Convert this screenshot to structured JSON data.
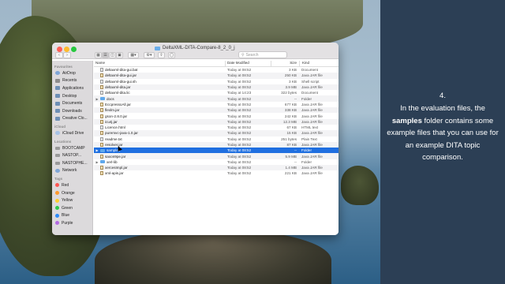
{
  "window": {
    "title": "DeltaXML-DITA-Compare-8_2_0_j",
    "search_placeholder": "Search"
  },
  "sidebar": {
    "sections": [
      {
        "header": "Favourites",
        "items": [
          {
            "label": "AirDrop",
            "icon": "airdrop-icon"
          },
          {
            "label": "Recents",
            "icon": "clock-icon"
          },
          {
            "label": "Applications",
            "icon": "applications-icon"
          },
          {
            "label": "Desktop",
            "icon": "desktop-icon"
          },
          {
            "label": "Documents",
            "icon": "document-icon"
          },
          {
            "label": "Downloads",
            "icon": "download-icon"
          },
          {
            "label": "Creative Clo...",
            "icon": "folder-icon"
          }
        ]
      },
      {
        "header": "iCloud",
        "items": [
          {
            "label": "iCloud Drive",
            "icon": "cloud-icon"
          }
        ]
      },
      {
        "header": "Locations",
        "items": [
          {
            "label": "BOOTCAMP",
            "icon": "drive-icon"
          },
          {
            "label": "NASTOP...",
            "icon": "drive-icon"
          },
          {
            "label": "NASTOPHE...",
            "icon": "drive-icon"
          },
          {
            "label": "Network",
            "icon": "network-icon"
          }
        ]
      }
    ],
    "tags_header": "Tags",
    "tags": [
      {
        "label": "Red",
        "color": "#fc5753"
      },
      {
        "label": "Orange",
        "color": "#fd9a2d"
      },
      {
        "label": "Yellow",
        "color": "#fecf2f"
      },
      {
        "label": "Green",
        "color": "#2fc84a"
      },
      {
        "label": "Blue",
        "color": "#2d8bf7"
      },
      {
        "label": "Purple",
        "color": "#b36ae2"
      }
    ]
  },
  "list": {
    "columns": {
      "name": "Name",
      "date": "Date Modified",
      "size": "Size",
      "kind": "Kind"
    },
    "rows": [
      {
        "name": "deltaxml-dita-gui.bat",
        "date": "Today at 08:52",
        "size": "3 KB",
        "kind": "Document",
        "type": "file"
      },
      {
        "name": "deltaxml-dita-gui.jar",
        "date": "Today at 08:52",
        "size": "250 KB",
        "kind": "Java JAR file",
        "type": "jar"
      },
      {
        "name": "deltaxml-dita-gui.sh",
        "date": "Today at 08:52",
        "size": "3 KB",
        "kind": "Shell script",
        "type": "file"
      },
      {
        "name": "deltaxml-dita.jar",
        "date": "Today at 08:52",
        "size": "3.9 MB",
        "kind": "Java JAR file",
        "type": "jar"
      },
      {
        "name": "deltaxml-dita.lic",
        "date": "Today at 14:23",
        "size": "322 bytes",
        "kind": "Document",
        "type": "file"
      },
      {
        "name": "docs",
        "date": "Today at 08:52",
        "size": "--",
        "kind": "Folder",
        "type": "folder"
      },
      {
        "name": "EccpressoAll.jar",
        "date": "Today at 08:52",
        "size": "677 KB",
        "kind": "Java JAR file",
        "type": "jar"
      },
      {
        "name": "flexlm.jar",
        "date": "Today at 08:52",
        "size": "338 KB",
        "kind": "Java JAR file",
        "type": "jar"
      },
      {
        "name": "gson-2.8.0.jar",
        "date": "Today at 08:52",
        "size": "242 KB",
        "kind": "Java JAR file",
        "type": "jar"
      },
      {
        "name": "icu4j.jar",
        "date": "Today at 08:52",
        "size": "12.3 MB",
        "kind": "Java JAR file",
        "type": "jar"
      },
      {
        "name": "Licence.html",
        "date": "Today at 08:52",
        "size": "67 KB",
        "kind": "HTML text",
        "type": "file"
      },
      {
        "name": "puremvc-java-1.0.jar",
        "date": "Today at 08:52",
        "size": "15 KB",
        "kind": "Java JAR file",
        "type": "jar"
      },
      {
        "name": "readme.txt",
        "date": "Today at 08:52",
        "size": "251 bytes",
        "kind": "Plain Text",
        "type": "file"
      },
      {
        "name": "resolver.jar",
        "date": "Today at 08:52",
        "size": "87 KB",
        "kind": "Java JAR file",
        "type": "jar"
      },
      {
        "name": "samples",
        "date": "Today at 08:52",
        "size": "--",
        "kind": "Folder",
        "type": "folder",
        "selected": true
      },
      {
        "name": "saxon9pe.jar",
        "date": "Today at 08:52",
        "size": "5.9 MB",
        "kind": "Java JAR file",
        "type": "jar"
      },
      {
        "name": "xerl-lib",
        "date": "Today at 08:52",
        "size": "--",
        "kind": "Folder",
        "type": "folder"
      },
      {
        "name": "xercesImpl.jar",
        "date": "Today at 08:52",
        "size": "1.4 MB",
        "kind": "Java JAR file",
        "type": "jar"
      },
      {
        "name": "xml-apis.jar",
        "date": "Today at 08:52",
        "size": "221 KB",
        "kind": "Java JAR file",
        "type": "jar"
      }
    ]
  },
  "panel": {
    "step": "4.",
    "text_before": "In the evaluation files, the ",
    "text_bold": "samples",
    "text_after": " folder contains some example files that you can use for an example DITA topic comparison."
  }
}
